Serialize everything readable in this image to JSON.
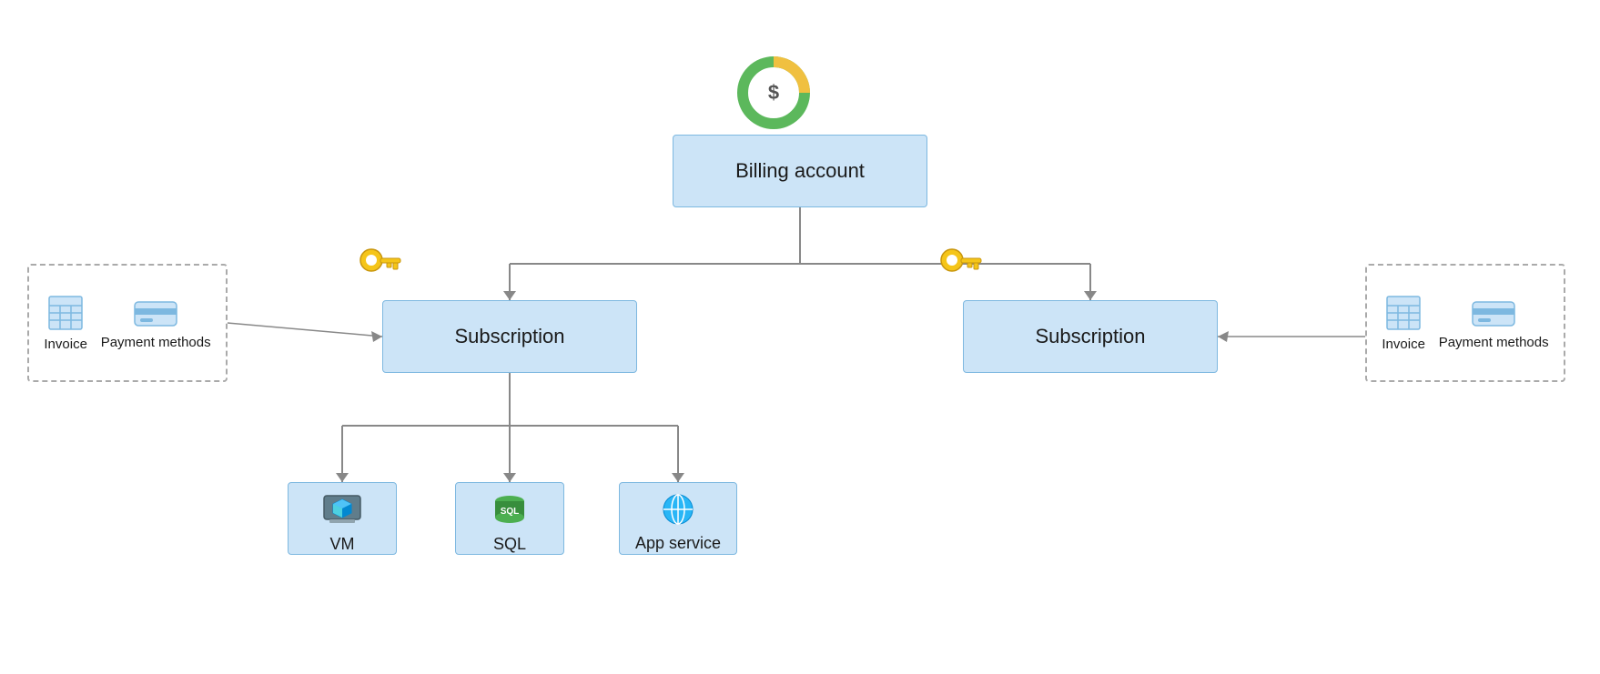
{
  "billing": {
    "label": "Billing account",
    "icon_label": "billing-icon"
  },
  "subscriptions": [
    {
      "id": "sub-left",
      "label": "Subscription"
    },
    {
      "id": "sub-right",
      "label": "Subscription"
    }
  ],
  "resources": [
    {
      "id": "vm",
      "label": "VM"
    },
    {
      "id": "sql",
      "label": "SQL"
    },
    {
      "id": "app",
      "label": "App service"
    }
  ],
  "left_dashed": {
    "invoice_label": "Invoice",
    "payment_label": "Payment methods"
  },
  "right_dashed": {
    "invoice_label": "Invoice",
    "payment_label": "Payment methods"
  }
}
